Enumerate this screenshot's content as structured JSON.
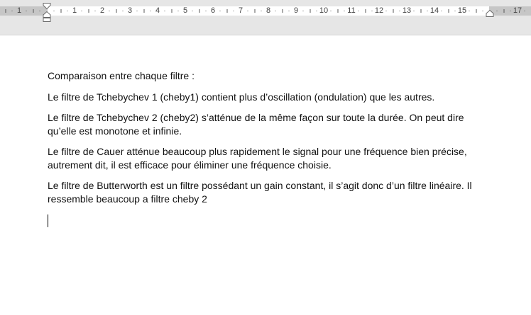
{
  "ruler": {
    "left_numbers": [
      "2",
      "1"
    ],
    "numbers": [
      "1",
      "2",
      "3",
      "4",
      "5",
      "6",
      "7",
      "8",
      "9",
      "10",
      "11",
      "12",
      "13",
      "14",
      "15"
    ],
    "right_numbers": [
      "17"
    ]
  },
  "document": {
    "paragraphs": [
      "Comparaison entre chaque filtre :",
      "Le filtre de Tchebychev 1 (cheby1) contient plus d’oscillation (ondulation) que les autres.",
      "Le filtre de Tchebychev 2 (cheby2) s’atténue de la même façon sur toute la durée. On peut dire qu’elle est monotone et infinie.",
      "Le filtre de Cauer atténue beaucoup plus rapidement le signal pour une fréquence bien précise, autrement dit, il est efficace pour éliminer une fréquence choisie.",
      "Le filtre de Butterworth est un filtre possédant un gain constant, il s’agit donc d’un filtre linéaire. Il ressemble beaucoup a filtre cheby 2"
    ]
  }
}
